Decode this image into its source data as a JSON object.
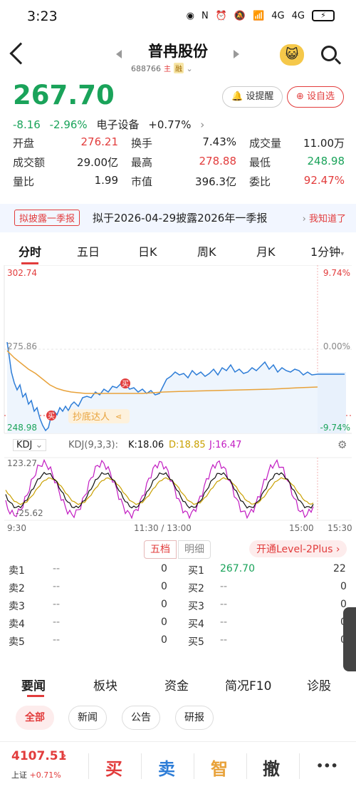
{
  "status": {
    "time": "3:23",
    "net1": "4G",
    "net2": "4G"
  },
  "header": {
    "title": "普冉股份",
    "code": "688766",
    "tag1": "主",
    "tag2": "融"
  },
  "quote": {
    "price": "267.70",
    "change": "-8.16",
    "change_pct": "-2.96%",
    "sector": "电子设备",
    "sector_pct": "+0.77%",
    "remind_label": "设提醒",
    "fav_label": "设自选"
  },
  "stats": [
    [
      {
        "label": "开盘",
        "value": "276.21",
        "color": "red"
      },
      {
        "label": "换手",
        "value": "7.43%",
        "color": "black"
      },
      {
        "label": "成交量",
        "value": "11.00万",
        "color": "black"
      }
    ],
    [
      {
        "label": "成交额",
        "value": "29.00亿",
        "color": "black"
      },
      {
        "label": "最高",
        "value": "278.88",
        "color": "red"
      },
      {
        "label": "最低",
        "value": "248.98",
        "color": "green"
      }
    ],
    [
      {
        "label": "量比",
        "value": "1.99",
        "color": "black"
      },
      {
        "label": "市值",
        "value": "396.3亿",
        "color": "black"
      },
      {
        "label": "委比",
        "value": "92.47%",
        "color": "red"
      }
    ]
  ],
  "banner": {
    "tag": "拟披露一季报",
    "text": "拟于2026-04-29披露2026年一季报",
    "ok": "我知道了"
  },
  "tabs": [
    "分时",
    "五日",
    "日K",
    "周K",
    "月K",
    "1分钟"
  ],
  "chart": {
    "y_top": "302.74",
    "y_mid": "275.86",
    "y_bot": "248.98",
    "pct_top": "9.74%",
    "pct_mid": "0.00%",
    "pct_bot": "-9.74%",
    "buy_mark": "买",
    "badge": "抄底达人"
  },
  "kdj": {
    "name": "KDJ",
    "params": "KDJ(9,3,3):",
    "k": "K:18.06",
    "d": "D:18.85",
    "j": "J:16.47",
    "top": "123.27",
    "bot": "-25.62"
  },
  "time_axis": {
    "start": "9:30",
    "mid": "11:30 / 13:00",
    "end1": "15:00",
    "end2": "15:30"
  },
  "book_tabs": {
    "tab1": "五档",
    "tab2": "明细",
    "level2": "开通Level-2Plus"
  },
  "sell": [
    {
      "label": "卖1",
      "price": "--",
      "vol": "0"
    },
    {
      "label": "卖2",
      "price": "--",
      "vol": "0"
    },
    {
      "label": "卖3",
      "price": "--",
      "vol": "0"
    },
    {
      "label": "卖4",
      "price": "--",
      "vol": "0"
    },
    {
      "label": "卖5",
      "price": "--",
      "vol": "0"
    }
  ],
  "buy": [
    {
      "label": "买1",
      "price": "267.70",
      "vol": "22"
    },
    {
      "label": "买2",
      "price": "--",
      "vol": "0"
    },
    {
      "label": "买3",
      "price": "--",
      "vol": "0"
    },
    {
      "label": "买4",
      "price": "--",
      "vol": "0"
    },
    {
      "label": "买5",
      "price": "--",
      "vol": "0"
    }
  ],
  "news_tabs": [
    "要闻",
    "板块",
    "资金",
    "简况F10",
    "诊股"
  ],
  "pills": [
    "全部",
    "新闻",
    "公告",
    "研报"
  ],
  "bottom": {
    "index": "4107.51",
    "index_name": "上证",
    "index_pct": "+0.71%",
    "buy": "买",
    "sell": "卖",
    "smart": "智",
    "cancel": "撤",
    "more": "•••"
  },
  "colors": {
    "red": "#e23c3c",
    "green": "#1aa35a",
    "blue": "#2e7dd7",
    "orange": "#e8a23a"
  }
}
